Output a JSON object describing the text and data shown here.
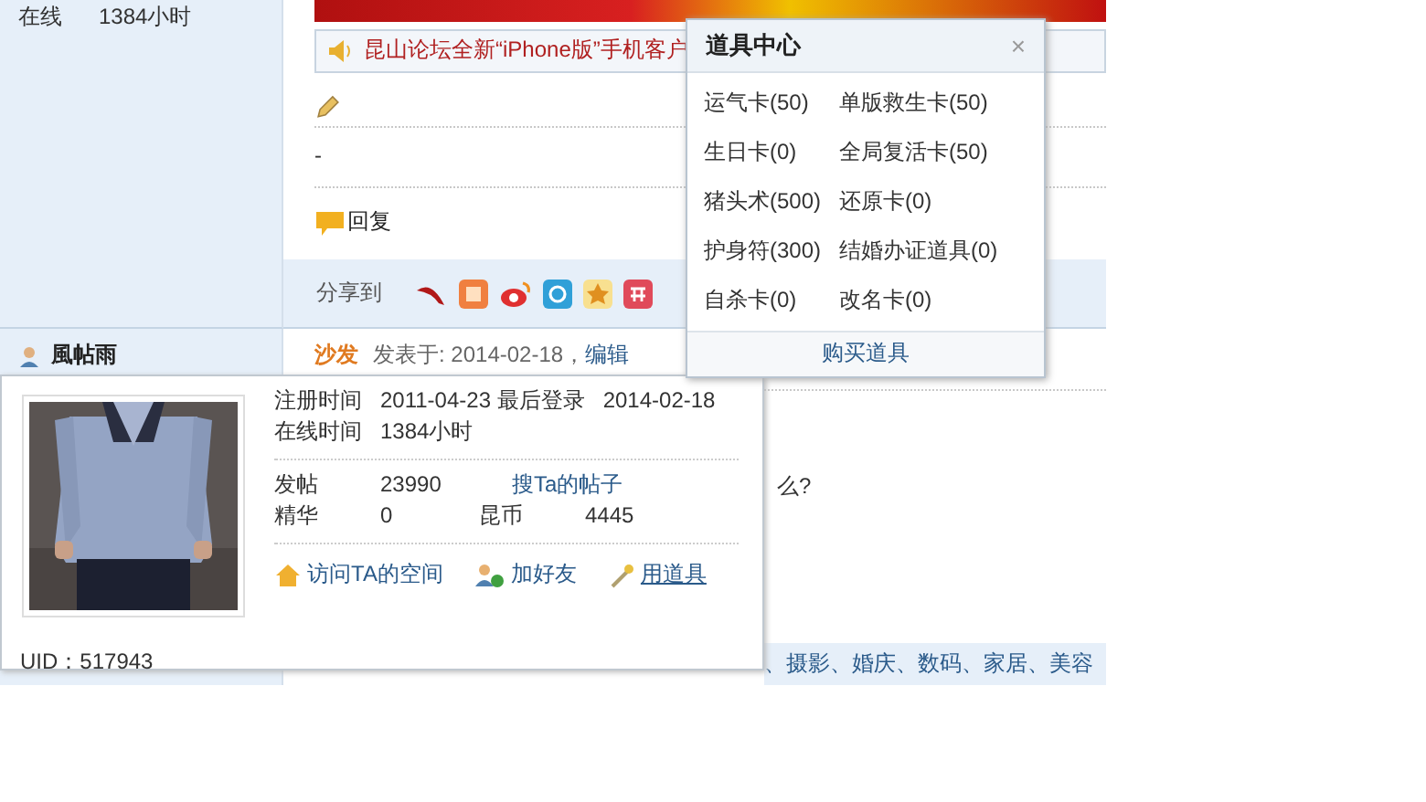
{
  "first_post": {
    "sidebar": {
      "label": "在线",
      "value": "1384小时"
    },
    "notice": "昆山论坛全新“iPhone版”手机客户",
    "body": "-",
    "reply_button": "回复",
    "share_label": "分享到"
  },
  "second_post": {
    "author": "風帖雨",
    "badge": "沙发",
    "posted": "发表于: 2014-02-18，",
    "edit_link": "编辑",
    "body_fragment": "么?",
    "tags_fragment": "、摄影、婚庆、数码、家居、美容"
  },
  "profile_card": {
    "rows": [
      [
        {
          "kind": "label",
          "text": "注册时间"
        },
        {
          "kind": "value",
          "text": "2011-04-23 最后登录"
        },
        {
          "kind": "value",
          "text": "2014-02-18"
        }
      ],
      [
        {
          "kind": "label",
          "text": "在线时间"
        },
        {
          "kind": "value",
          "text": "1384小时"
        }
      ],
      [
        {
          "kind": "label",
          "text": "发帖"
        },
        {
          "kind": "value",
          "text": "23990"
        },
        {
          "kind": "link",
          "text": "搜Ta的帖子"
        }
      ],
      [
        {
          "kind": "label",
          "text": "精华"
        },
        {
          "kind": "value",
          "text": "0"
        },
        {
          "kind": "label",
          "text": "昆币"
        },
        {
          "kind": "value",
          "text": "4445"
        }
      ]
    ],
    "actions": [
      {
        "kind": "home",
        "label": "访问TA的空间",
        "underlined": false
      },
      {
        "kind": "friend",
        "label": "加好友",
        "underlined": false
      },
      {
        "kind": "wand",
        "label": "用道具",
        "underlined": true
      }
    ],
    "uid": "UID：517943"
  },
  "props_popup": {
    "title": "道具中心",
    "close": "×",
    "items": [
      "运气卡(50)",
      "单版救生卡(50)",
      "生日卡(0)",
      "全局复活卡(50)",
      "猪头术(500)",
      "还原卡(0)",
      "护身符(300)",
      "结婚办证道具(0)",
      "自杀卡(0)",
      "改名卡(0)"
    ],
    "footer": "购买道具"
  }
}
